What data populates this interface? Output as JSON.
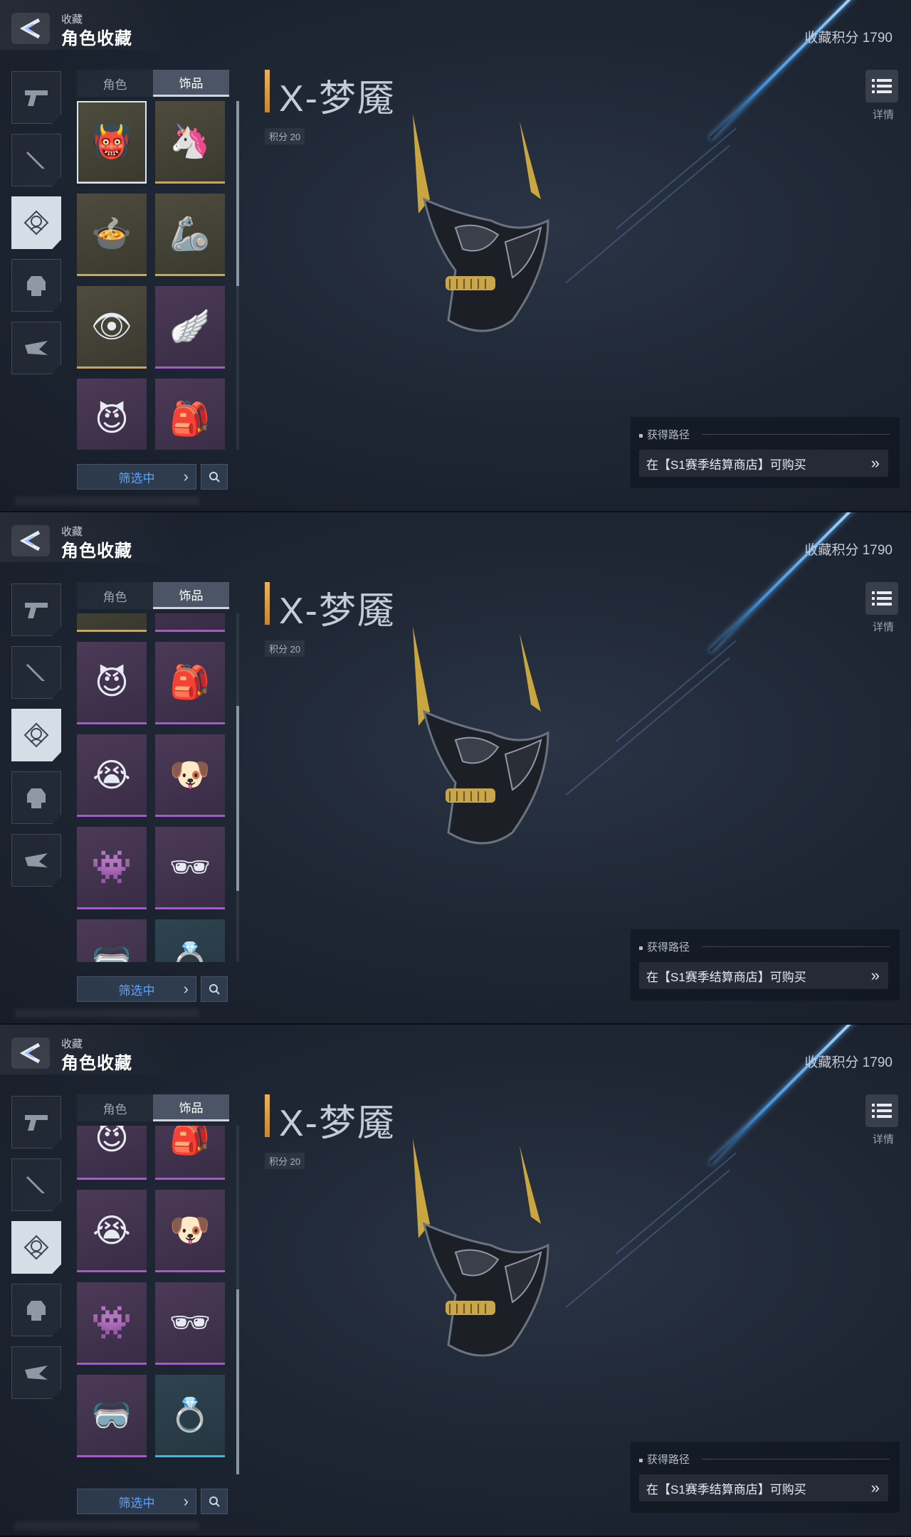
{
  "header": {
    "breadcrumb": "收藏",
    "title": "角色收藏",
    "score_label": "收藏积分 1790"
  },
  "tabs": [
    {
      "label": "角色"
    },
    {
      "label": "饰品"
    }
  ],
  "filter": {
    "label": "筛选中"
  },
  "item": {
    "name": "X-梦魇",
    "points": "积分 20"
  },
  "detail": {
    "label": "详情"
  },
  "acquire": {
    "title": "获得路径",
    "text": "在【S1赛季结算商店】可购买"
  },
  "sidebar": {
    "icons": [
      "pistol-icon",
      "knife-icon",
      "character-icon",
      "armor-icon",
      "glider-icon"
    ],
    "active_index": 2
  },
  "collection_items": [
    {
      "icon": "nightmare-mask",
      "glyph": "👹",
      "rarity": "gold"
    },
    {
      "icon": "unicorn-head",
      "glyph": "🦄",
      "rarity": "gold"
    },
    {
      "icon": "hotpot-ufo",
      "glyph": "🍲",
      "rarity": "gold"
    },
    {
      "icon": "mech-armor",
      "glyph": "🦾",
      "rarity": "gold"
    },
    {
      "icon": "eye-drone",
      "glyph": "👁",
      "rarity": "gold"
    },
    {
      "icon": "mech-wings",
      "glyph": "🪽",
      "rarity": "purple"
    },
    {
      "icon": "devil-cat",
      "glyph": "😈",
      "rarity": "purple"
    },
    {
      "icon": "red-backpack",
      "glyph": "🎒",
      "rarity": "purple"
    },
    {
      "icon": "crying-emoji",
      "glyph": "😭",
      "rarity": "purple"
    },
    {
      "icon": "shiba-dog",
      "glyph": "🐶",
      "rarity": "purple"
    },
    {
      "icon": "blue-monster",
      "glyph": "👾",
      "rarity": "purple"
    },
    {
      "icon": "dark-sunglasses",
      "glyph": "🕶",
      "rarity": "purple"
    },
    {
      "icon": "winged-glasses",
      "glyph": "🥽",
      "rarity": "purple"
    },
    {
      "icon": "cyber-ring",
      "glyph": "💍",
      "rarity": "blue"
    }
  ],
  "colors": {
    "accent_blue": "#5aa6ff",
    "gold": "#d6a53c",
    "purple": "#b44ee0",
    "blue": "#3fb7e6"
  }
}
